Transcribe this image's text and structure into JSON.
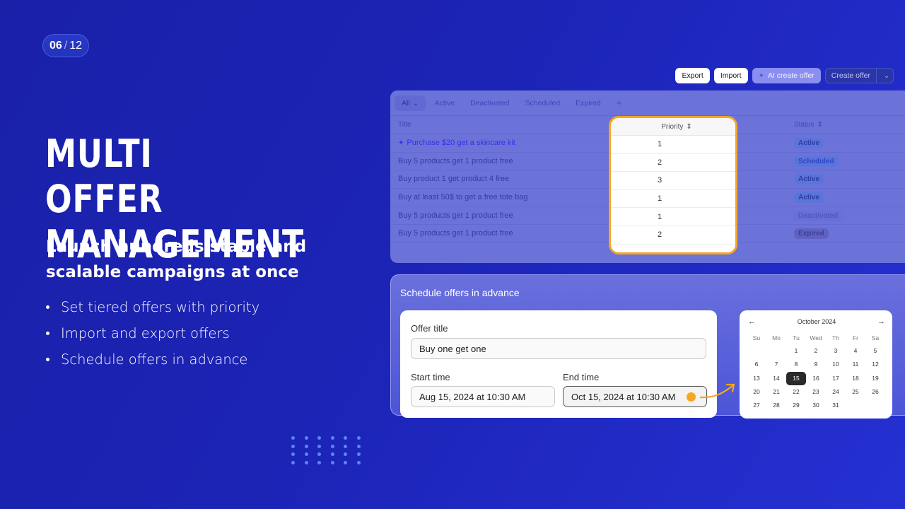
{
  "slide": {
    "current": "06",
    "separator": "/",
    "total": "12"
  },
  "hero": {
    "headline_line1": "Multi offer",
    "headline_line2": "management",
    "subheadline": "Launch hundreds stable and scalable campaigns at once",
    "bullets": [
      "Set tiered offers with priority",
      "Import and export offers",
      "Schedule offers in advance"
    ]
  },
  "toolbar": {
    "export_label": "Export",
    "import_label": "Import",
    "ai_create_label": "AI create offer",
    "ai_icon": "sparkle-icon",
    "create_label": "Create offer",
    "create_caret": "⌄"
  },
  "offers_table": {
    "tabs": [
      {
        "label": "All",
        "active": true
      },
      {
        "label": "Active"
      },
      {
        "label": "Deactivated"
      },
      {
        "label": "Scheduled"
      },
      {
        "label": "Expired"
      },
      {
        "label": "+"
      }
    ],
    "columns": {
      "title": "Title",
      "priority": "Priority",
      "status": "Status"
    },
    "rows": [
      {
        "title": "Purchase $20 get a skincare kit",
        "ai": true,
        "priority": "1",
        "status": "Active"
      },
      {
        "title": "Buy 5 products get 1 product free",
        "priority": "2",
        "status": "Scheduled"
      },
      {
        "title": "Buy product 1 get product 4 free",
        "priority": "3",
        "status": "Active"
      },
      {
        "title": "Buy at least 50$ to get a free tote bag",
        "priority": "1",
        "status": "Active"
      },
      {
        "title": "Buy 5 products get 1 product free",
        "priority": "1",
        "status": "Deactivated"
      },
      {
        "title": "Buy 5 products get 1 product free",
        "priority": "2",
        "status": "Expired"
      }
    ]
  },
  "schedule": {
    "title": "Schedule offers in advance",
    "offer_title_label": "Offer title",
    "offer_title_value": "Buy one get one",
    "start_label": "Start time",
    "start_value": "Aug 15, 2024 at 10:30 AM",
    "end_label": "End time",
    "end_value": "Oct 15, 2024 at 10:30 AM"
  },
  "calendar": {
    "month": "October 2024",
    "prev": "←",
    "next": "→",
    "weekdays": [
      "Su",
      "Mo",
      "Tu",
      "Wed",
      "Th",
      "Fr",
      "Sa"
    ],
    "first_weekday_index": 2,
    "days_in_month": 31,
    "selected_day": 15
  },
  "colors": {
    "accent_orange": "#f5a623",
    "background_blue": "#1c24b6"
  }
}
